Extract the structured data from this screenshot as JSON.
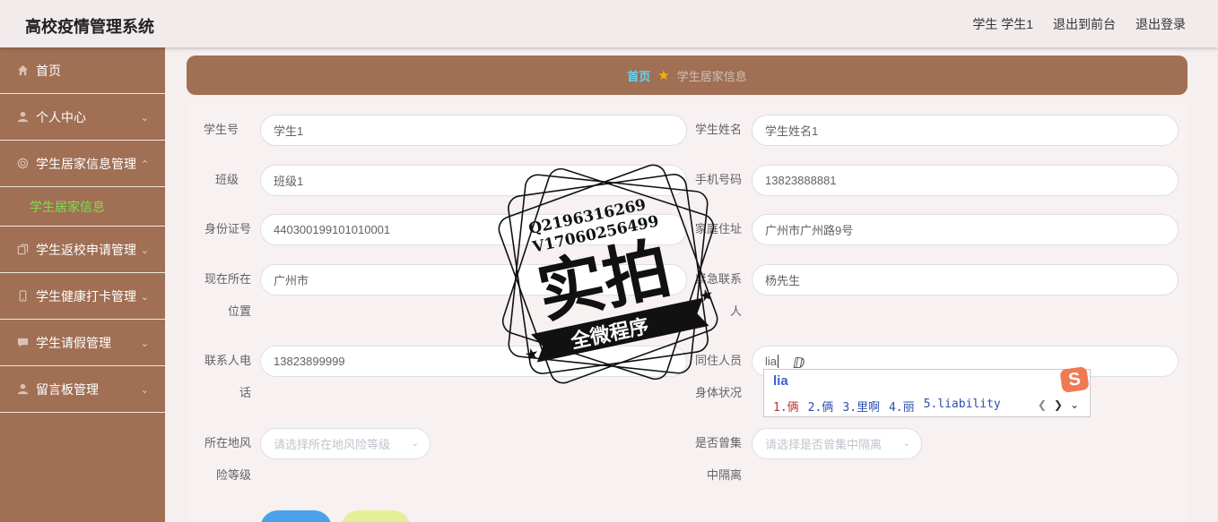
{
  "header": {
    "title": "高校疫情管理系统",
    "nav": [
      "学生 学生1",
      "退出到前台",
      "退出登录"
    ]
  },
  "sidebar": {
    "items": [
      {
        "label": "首页",
        "icon": "home-icon"
      },
      {
        "label": "个人中心",
        "icon": "user-icon"
      },
      {
        "label": "学生居家信息管理",
        "icon": "circle-icon",
        "expanded": true,
        "sub": "学生居家信息"
      },
      {
        "label": "学生返校申请管理",
        "icon": "copy-icon"
      },
      {
        "label": "学生健康打卡管理",
        "icon": "phone-icon"
      },
      {
        "label": "学生请假管理",
        "icon": "chat-icon"
      },
      {
        "label": "留言板管理",
        "icon": "user-icon"
      }
    ]
  },
  "breadcrumb": {
    "home": "首页",
    "current": "学生居家信息"
  },
  "form": {
    "student_no": {
      "label": "学生号",
      "value": "学生1"
    },
    "student_name": {
      "label": "学生姓名",
      "value": "学生姓名1"
    },
    "class": {
      "label": "班级",
      "value": "班级1"
    },
    "phone": {
      "label": "手机号码",
      "value": "13823888881"
    },
    "id_card": {
      "label": "身份证号",
      "value": "440300199101010001"
    },
    "address": {
      "label": "家庭住址",
      "value": "广州市广州路9号"
    },
    "location": {
      "label1": "现在所在",
      "label2": "位置",
      "value": "广州市"
    },
    "emergency": {
      "label1": "紧急联系",
      "label2": "人",
      "value": "杨先生"
    },
    "contact_phone": {
      "label1": "联系人电",
      "label2": "话",
      "value": "13823899999"
    },
    "cohabitant": {
      "label": "同住人员",
      "value": "lia"
    },
    "health": {
      "label": "身体状况"
    },
    "risk": {
      "label1": "所在地风",
      "label2": "险等级",
      "placeholder": "请选择所在地风险等级"
    },
    "quarantine": {
      "label1": "是否曾集",
      "label2": "中隔离",
      "placeholder": "请选择是否曾集中隔离"
    }
  },
  "stamp": {
    "line1": "Q2196316269",
    "line2": "V17060256499",
    "main": "实拍",
    "banner": "全微程序"
  },
  "ime": {
    "composition": "lia",
    "candidates": [
      "1.俩",
      "2.俩",
      "3.里啊",
      "4.丽",
      "5.liability"
    ],
    "logo": "S"
  },
  "colors": {
    "sidebar": "#a06f54",
    "accent": "#7ee04e",
    "crumb_home": "#5fd8f2"
  }
}
